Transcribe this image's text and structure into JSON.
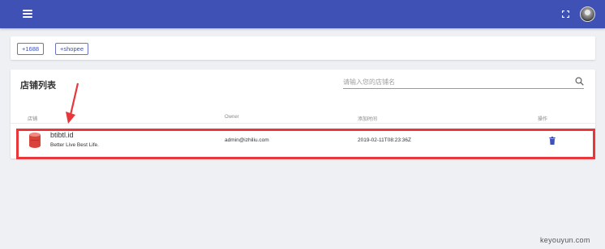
{
  "colors": {
    "primary": "#3f51b5",
    "highlight": "#e8363a",
    "background": "#eef0f3"
  },
  "topbar": {
    "menu_icon": "hamburger-menu-icon",
    "fullscreen_icon": "fullscreen-icon",
    "avatar_icon": "user-avatar"
  },
  "toolbar": {
    "chips": [
      "+1688",
      "+shopee"
    ]
  },
  "shop_list": {
    "title": "店铺列表",
    "search": {
      "placeholder": "请输入您的店铺名",
      "value": "",
      "icon": "search-icon"
    },
    "columns": [
      "店铺",
      "Owner",
      "添加时间",
      "操作"
    ],
    "rows": [
      {
        "shop_name": "btibtl.id",
        "shop_desc": "Better Live Best Life.",
        "owner": "admin@izhiliu.com",
        "added_time": "2019-02-11T08:23:36Z",
        "action_icon": "trash-icon",
        "logo_icon": "shop-logo-icon"
      }
    ]
  },
  "annotations": {
    "highlight": "red-rectangle-around-row",
    "arrow": "red-arrow-pointing-down"
  },
  "watermark": "keyouyun.com"
}
